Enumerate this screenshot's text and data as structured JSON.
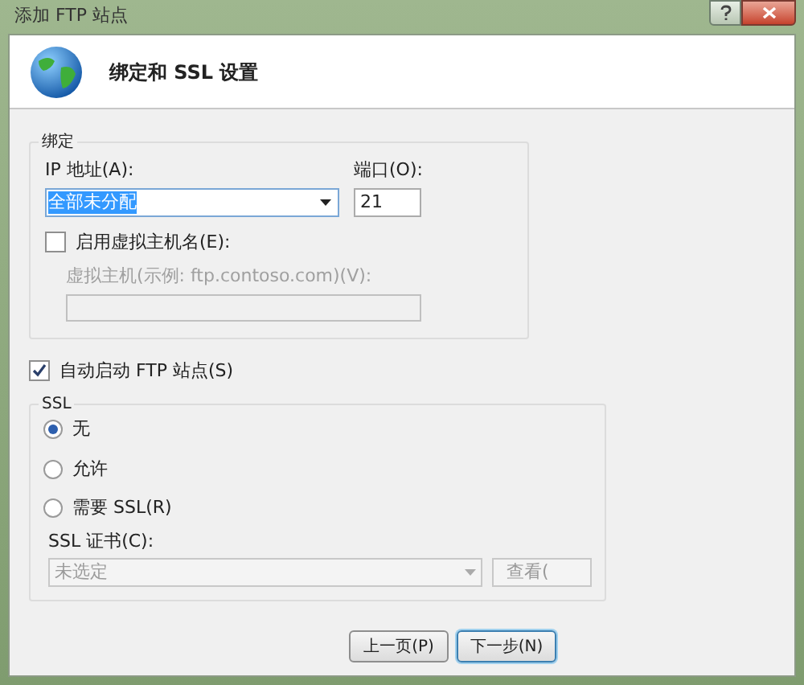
{
  "window": {
    "title": "添加 FTP 站点"
  },
  "header": {
    "title": "绑定和 SSL 设置"
  },
  "binding": {
    "legend": "绑定",
    "ip_label": "IP 地址(A):",
    "ip_value": "全部未分配",
    "port_label": "端口(O):",
    "port_value": "21",
    "virtual_host": {
      "label": "启用虚拟主机名(E):",
      "checked": false
    },
    "host_label": "虚拟主机(示例: ftp.contoso.com)(V):",
    "host_disabled": true
  },
  "auto_start": {
    "label": "自动启动 FTP 站点(S)",
    "checked": true
  },
  "ssl": {
    "legend": "SSL",
    "options": [
      {
        "label": "无",
        "selected": true
      },
      {
        "label": "允许",
        "selected": false
      },
      {
        "label": "需要 SSL(R)",
        "selected": false
      }
    ],
    "cert_label": "SSL 证书(C):",
    "cert_value": "未选定",
    "cert_disabled": true,
    "view_button": "查看("
  },
  "buttons": [
    {
      "label": "上一页(P)",
      "focused": false
    },
    {
      "label": "下一步(N)",
      "focused": true
    }
  ]
}
